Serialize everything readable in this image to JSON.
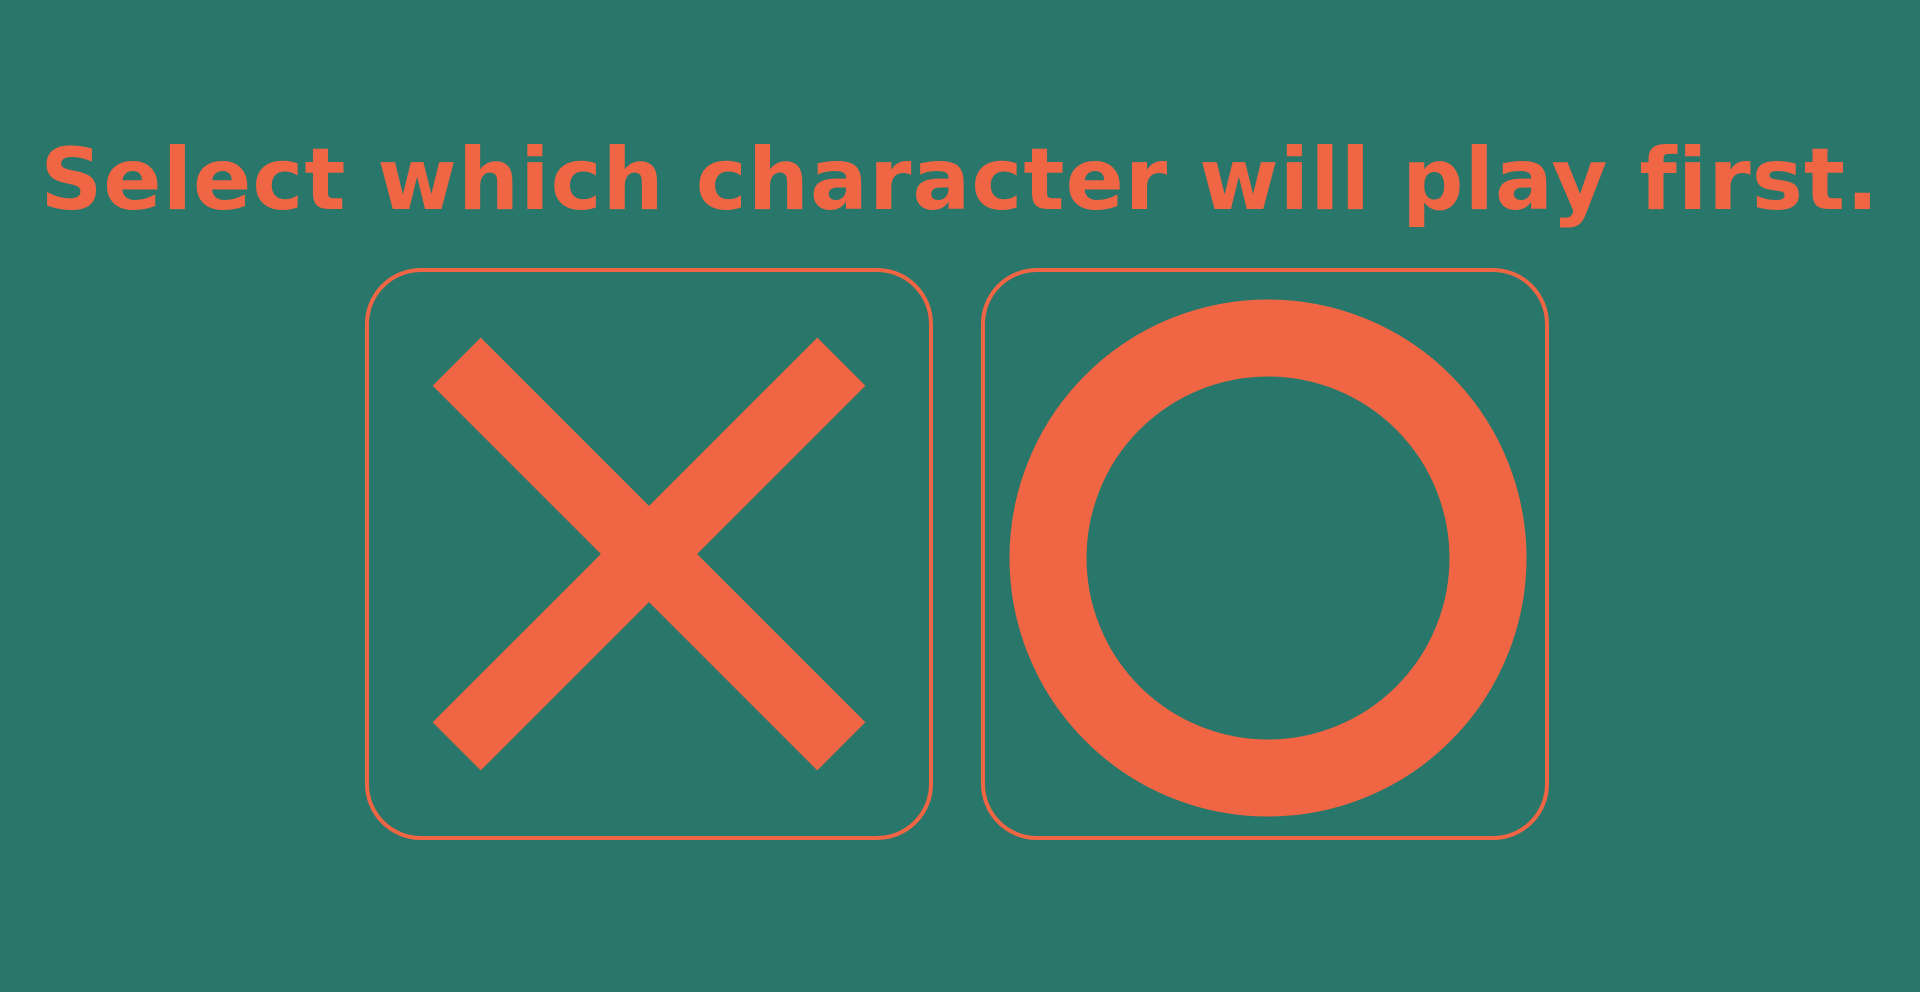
{
  "prompt": {
    "text": "Select which character will play first."
  },
  "choices": [
    {
      "label": "X",
      "icon": "x-mark-icon"
    },
    {
      "label": "O",
      "icon": "o-ring-icon"
    }
  ],
  "colors": {
    "background": "#29776a",
    "accent": "#f06543"
  }
}
